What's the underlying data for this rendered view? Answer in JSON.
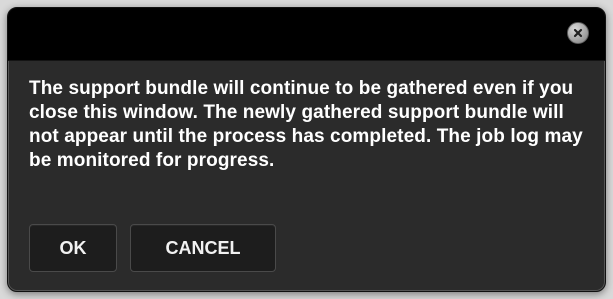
{
  "dialog": {
    "message": "The support bundle will continue to be gathered even if you close this window. The newly gathered support bundle will not appear until the process has completed. The job log may be monitored for progress.",
    "close_icon": "close-icon",
    "buttons": {
      "ok_label": "OK",
      "cancel_label": "CANCEL"
    }
  }
}
